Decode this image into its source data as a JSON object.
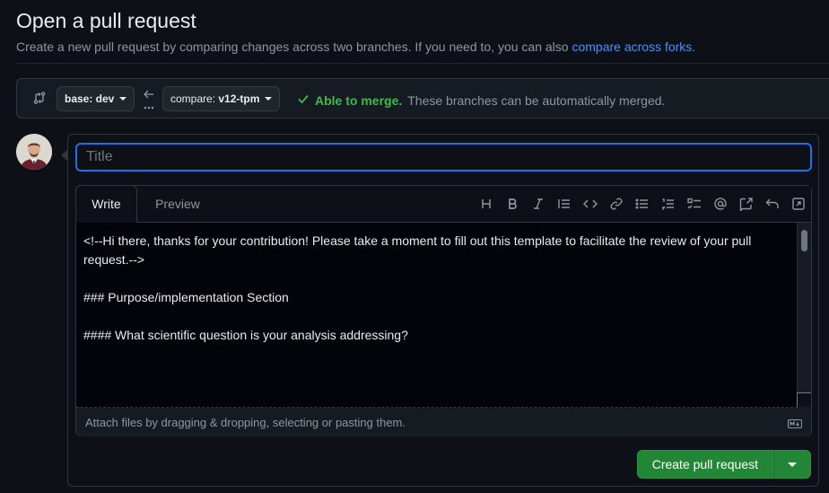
{
  "header": {
    "title": "Open a pull request",
    "subtitle": "Create a new pull request by comparing changes across two branches. If you need to, you can also",
    "link_label": "compare across forks",
    "link_suffix": "."
  },
  "branches": {
    "base_label": "base: dev",
    "compare_label": "compare:",
    "compare_value": "v12-tpm",
    "merge_status": "Able to merge.",
    "merge_message": "These branches can be automatically merged."
  },
  "form": {
    "title_placeholder": "Title",
    "tabs": [
      {
        "label": "Write"
      },
      {
        "label": "Preview"
      }
    ],
    "toolbar": [
      {
        "icon": "heading-icon",
        "glyph": "H"
      },
      {
        "icon": "bold-icon",
        "glyph": "B"
      },
      {
        "icon": "italic-icon",
        "glyph": "I"
      },
      {
        "icon": "quote-icon",
        "glyph": ""
      },
      {
        "icon": "code-icon",
        "glyph": ""
      },
      {
        "icon": "link-icon",
        "glyph": ""
      },
      {
        "icon": "unordered-list-icon",
        "glyph": ""
      },
      {
        "icon": "ordered-list-icon",
        "glyph": ""
      },
      {
        "icon": "task-list-icon",
        "glyph": ""
      },
      {
        "icon": "mention-icon",
        "glyph": "@"
      },
      {
        "icon": "cross-reference-icon",
        "glyph": ""
      },
      {
        "icon": "undo-icon",
        "glyph": ""
      },
      {
        "icon": "fullscreen-icon",
        "glyph": ""
      }
    ],
    "body_text": "<!--Hi there, thanks for your contribution! Please take a moment to fill out this template to facilitate the review of your pull request.-->\n\n### Purpose/implementation Section\n\n#### What scientific question is your analysis addressing?",
    "attach_hint": "Attach files by dragging & dropping, selecting or pasting them.",
    "submit_label": "Create pull request"
  },
  "colors": {
    "accent": "#1f6feb",
    "success": "#3fb950",
    "button": "#238636",
    "link": "#4493f8"
  }
}
